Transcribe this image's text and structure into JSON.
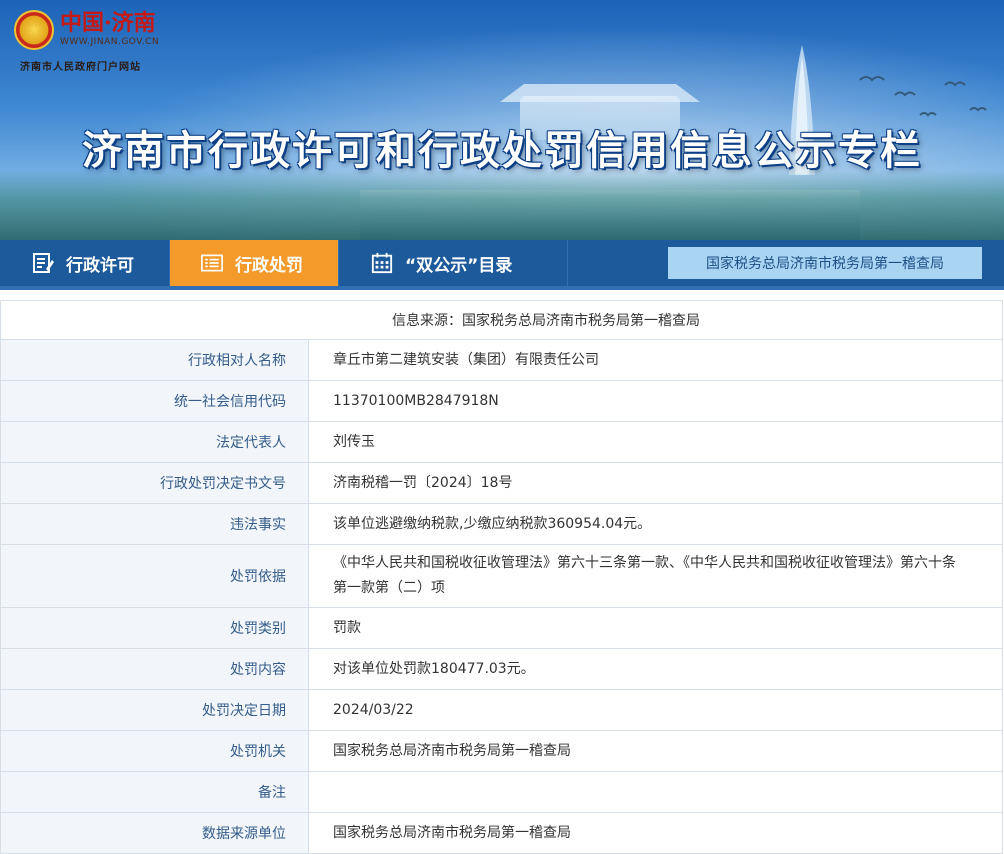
{
  "header": {
    "logo_name": "中国·济南",
    "logo_url": "WWW.JINAN.GOV.CN",
    "logo_sub": "济南市人民政府门户网站",
    "banner_title": "济南市行政许可和行政处罚信用信息公示专栏"
  },
  "nav": {
    "items": [
      {
        "label": "行政许可",
        "icon": "document-edit-icon"
      },
      {
        "label": "行政处罚",
        "icon": "list-icon",
        "active": true
      },
      {
        "label": "“双公示”目录",
        "icon": "calendar-icon"
      }
    ],
    "right_box": "国家税务总局济南市税务局第一稽查局"
  },
  "record": {
    "source_label": "信息来源：",
    "source_value": "国家税务总局济南市税务局第一稽查局",
    "rows": [
      {
        "label": "行政相对人名称",
        "value": "章丘市第二建筑安装（集团）有限责任公司"
      },
      {
        "label": "统一社会信用代码",
        "value": "11370100MB2847918N"
      },
      {
        "label": "法定代表人",
        "value": "刘传玉"
      },
      {
        "label": "行政处罚决定书文号",
        "value": "济南税稽一罚〔2024〕18号"
      },
      {
        "label": "违法事实",
        "value": "该单位逃避缴纳税款,少缴应纳税款360954.04元。"
      },
      {
        "label": "处罚依据",
        "value": "《中华人民共和国税收征收管理法》第六十三条第一款、《中华人民共和国税收征收管理法》第六十条第一款第（二）项"
      },
      {
        "label": "处罚类别",
        "value": "罚款"
      },
      {
        "label": "处罚内容",
        "value": "对该单位处罚款180477.03元。"
      },
      {
        "label": "处罚决定日期",
        "value": "2024/03/22"
      },
      {
        "label": "处罚机关",
        "value": "国家税务总局济南市税务局第一稽查局"
      },
      {
        "label": "备注",
        "value": ""
      },
      {
        "label": "数据来源单位",
        "value": "国家税务总局济南市税务局第一稽查局"
      }
    ]
  },
  "colors": {
    "nav_bg": "#1d5a9b",
    "nav_active": "#f39a2a",
    "label_bg": "#f2f6fb",
    "label_text": "#355c8a"
  }
}
